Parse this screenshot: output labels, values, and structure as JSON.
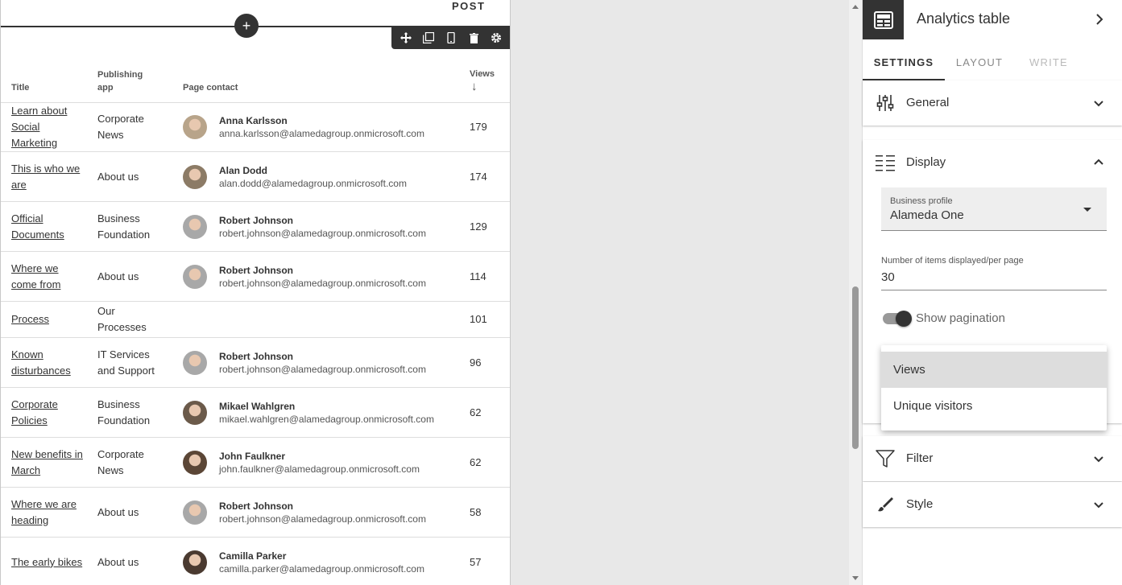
{
  "canvas": {
    "post_label": "POST",
    "add_symbol": "+",
    "toolbar_icons": [
      "move-icon",
      "copy-icon",
      "mobile-icon",
      "delete-icon",
      "settings-icon"
    ]
  },
  "table": {
    "headers": {
      "title": "Title",
      "publishing_app_line1": "Publishing",
      "publishing_app_line2": "app",
      "page_contact": "Page contact",
      "views": "Views",
      "sort_arrow": "↓"
    },
    "rows": [
      {
        "title": "Learn about Social Marketing",
        "app": "Corporate News",
        "name": "Anna Karlsson",
        "email": "anna.karlsson@alamedagroup.onmicrosoft.com",
        "views": "179",
        "avatar_color": "#b8a48a"
      },
      {
        "title": "This is who we are",
        "app": "About us",
        "name": "Alan Dodd",
        "email": "alan.dodd@alamedagroup.onmicrosoft.com",
        "views": "174",
        "avatar_color": "#8c7b66"
      },
      {
        "title": "Official Documents",
        "app": "Business Foundation",
        "name": "Robert Johnson",
        "email": "robert.johnson@alamedagroup.onmicrosoft.com",
        "views": "129",
        "avatar_color": "#a8a8a8"
      },
      {
        "title": "Where we come from",
        "app": "About us",
        "name": "Robert Johnson",
        "email": "robert.johnson@alamedagroup.onmicrosoft.com",
        "views": "114",
        "avatar_color": "#a8a8a8"
      },
      {
        "title": "Process",
        "app": "Our Processes",
        "name": "",
        "email": "",
        "views": "101",
        "avatar_color": ""
      },
      {
        "title": "Known disturbances",
        "app": "IT Services and Support",
        "name": "Robert Johnson",
        "email": "robert.johnson@alamedagroup.onmicrosoft.com",
        "views": "96",
        "avatar_color": "#a8a8a8"
      },
      {
        "title": "Corporate Policies",
        "app": "Business Foundation",
        "name": "Mikael Wahlgren",
        "email": "mikael.wahlgren@alamedagroup.onmicrosoft.com",
        "views": "62",
        "avatar_color": "#6b5a4a"
      },
      {
        "title": "New benefits in March",
        "app": "Corporate News",
        "name": "John Faulkner",
        "email": "john.faulkner@alamedagroup.onmicrosoft.com",
        "views": "62",
        "avatar_color": "#5b4636"
      },
      {
        "title": "Where we are heading",
        "app": "About us",
        "name": "Robert Johnson",
        "email": "robert.johnson@alamedagroup.onmicrosoft.com",
        "views": "58",
        "avatar_color": "#a8a8a8"
      },
      {
        "title": "The early bikes",
        "app": "About us",
        "name": "Camilla Parker",
        "email": "camilla.parker@alamedagroup.onmicrosoft.com",
        "views": "57",
        "avatar_color": "#4a3a30"
      }
    ]
  },
  "panel": {
    "title": "Analytics table",
    "tabs": {
      "settings": "SETTINGS",
      "layout": "LAYOUT",
      "write": "WRITE"
    },
    "sections": {
      "general": "General",
      "display": "Display",
      "filter": "Filter",
      "style": "Style"
    },
    "business_profile": {
      "label": "Business profile",
      "value": "Alameda One"
    },
    "items_per_page": {
      "label": "Number of items displayed/per page",
      "value": "30"
    },
    "pagination": {
      "label": "Show pagination"
    },
    "dropdown_options": [
      "Views",
      "Unique visitors"
    ]
  }
}
